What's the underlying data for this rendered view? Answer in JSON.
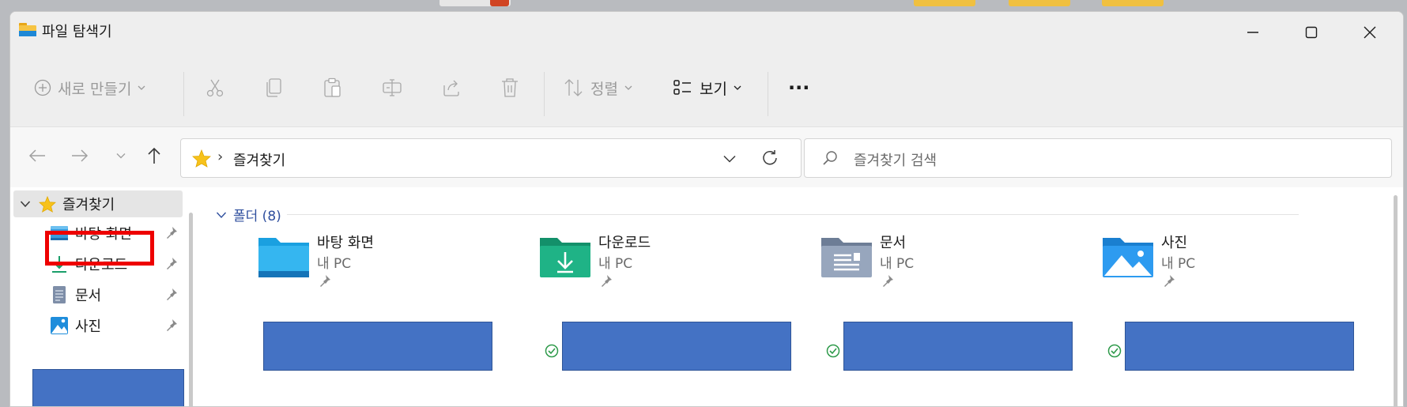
{
  "window": {
    "title": "파일 탐색기"
  },
  "toolbar": {
    "new_label": "새로 만들기",
    "sort_label": "정렬",
    "view_label": "보기",
    "more_label": "···"
  },
  "address": {
    "separator": "›",
    "crumb": "즐겨찾기",
    "search_placeholder": "즐겨찾기 검색"
  },
  "sidebar": {
    "favorites_label": "즐겨찾기",
    "items": [
      {
        "label": "바탕 화면",
        "icon": "desktop-icon"
      },
      {
        "label": "다운로드",
        "icon": "download-icon"
      },
      {
        "label": "문서",
        "icon": "document-icon"
      },
      {
        "label": "사진",
        "icon": "pictures-icon"
      }
    ]
  },
  "main": {
    "group_label": "폴더 (8)",
    "folders": [
      {
        "name": "바탕 화면",
        "location": "내 PC",
        "icon": "desktop-folder-icon"
      },
      {
        "name": "다운로드",
        "location": "내 PC",
        "icon": "downloads-folder-icon"
      },
      {
        "name": "문서",
        "location": "내 PC",
        "icon": "documents-folder-icon"
      },
      {
        "name": "사진",
        "location": "내 PC",
        "icon": "pictures-folder-icon"
      }
    ]
  },
  "colors": {
    "accent_folder": "#1e90d6",
    "redaction": "#4472c4",
    "highlight": "#ee0000",
    "group_text": "#2f4f9e"
  }
}
